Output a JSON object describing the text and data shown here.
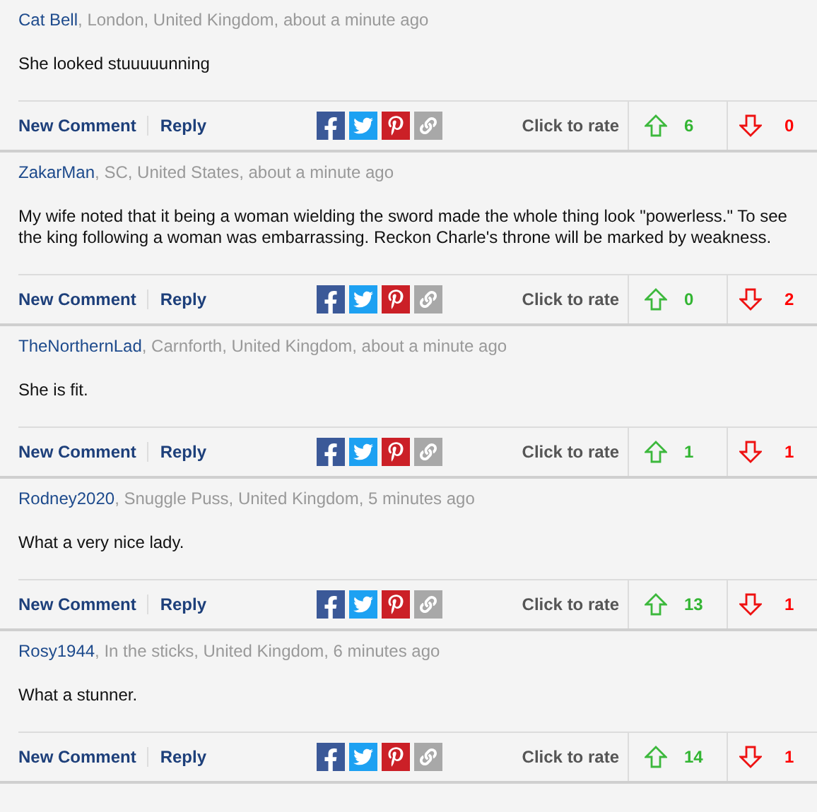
{
  "comments": [
    {
      "author": "Cat Bell",
      "meta": ", London, United Kingdom, about a minute ago",
      "body": "She looked stuuuuunning",
      "new_comment": "New Comment",
      "reply": "Reply",
      "rate_label": "Click to rate",
      "up": "6",
      "down": "0"
    },
    {
      "author": "ZakarMan",
      "meta": ", SC, United States, about a minute ago",
      "body": "My wife noted that it being a woman wielding the sword made the whole thing look \"powerless.\" To see the king following a woman was embarrassing. Reckon Charle's throne will be marked by weakness.",
      "new_comment": "New Comment",
      "reply": "Reply",
      "rate_label": "Click to rate",
      "up": "0",
      "down": "2"
    },
    {
      "author": "TheNorthernLad",
      "meta": ", Carnforth, United Kingdom, about a minute ago",
      "body": "She is fit.",
      "new_comment": "New Comment",
      "reply": "Reply",
      "rate_label": "Click to rate",
      "up": "1",
      "down": "1"
    },
    {
      "author": "Rodney2020",
      "meta": ", Snuggle Puss, United Kingdom, 5 minutes ago",
      "body": "What a very nice lady.",
      "new_comment": "New Comment",
      "reply": "Reply",
      "rate_label": "Click to rate",
      "up": "13",
      "down": "1"
    },
    {
      "author": "Rosy1944",
      "meta": ", In the sticks, United Kingdom, 6 minutes ago",
      "body": "What a stunner.",
      "new_comment": "New Comment",
      "reply": "Reply",
      "rate_label": "Click to rate",
      "up": "14",
      "down": "1"
    }
  ]
}
